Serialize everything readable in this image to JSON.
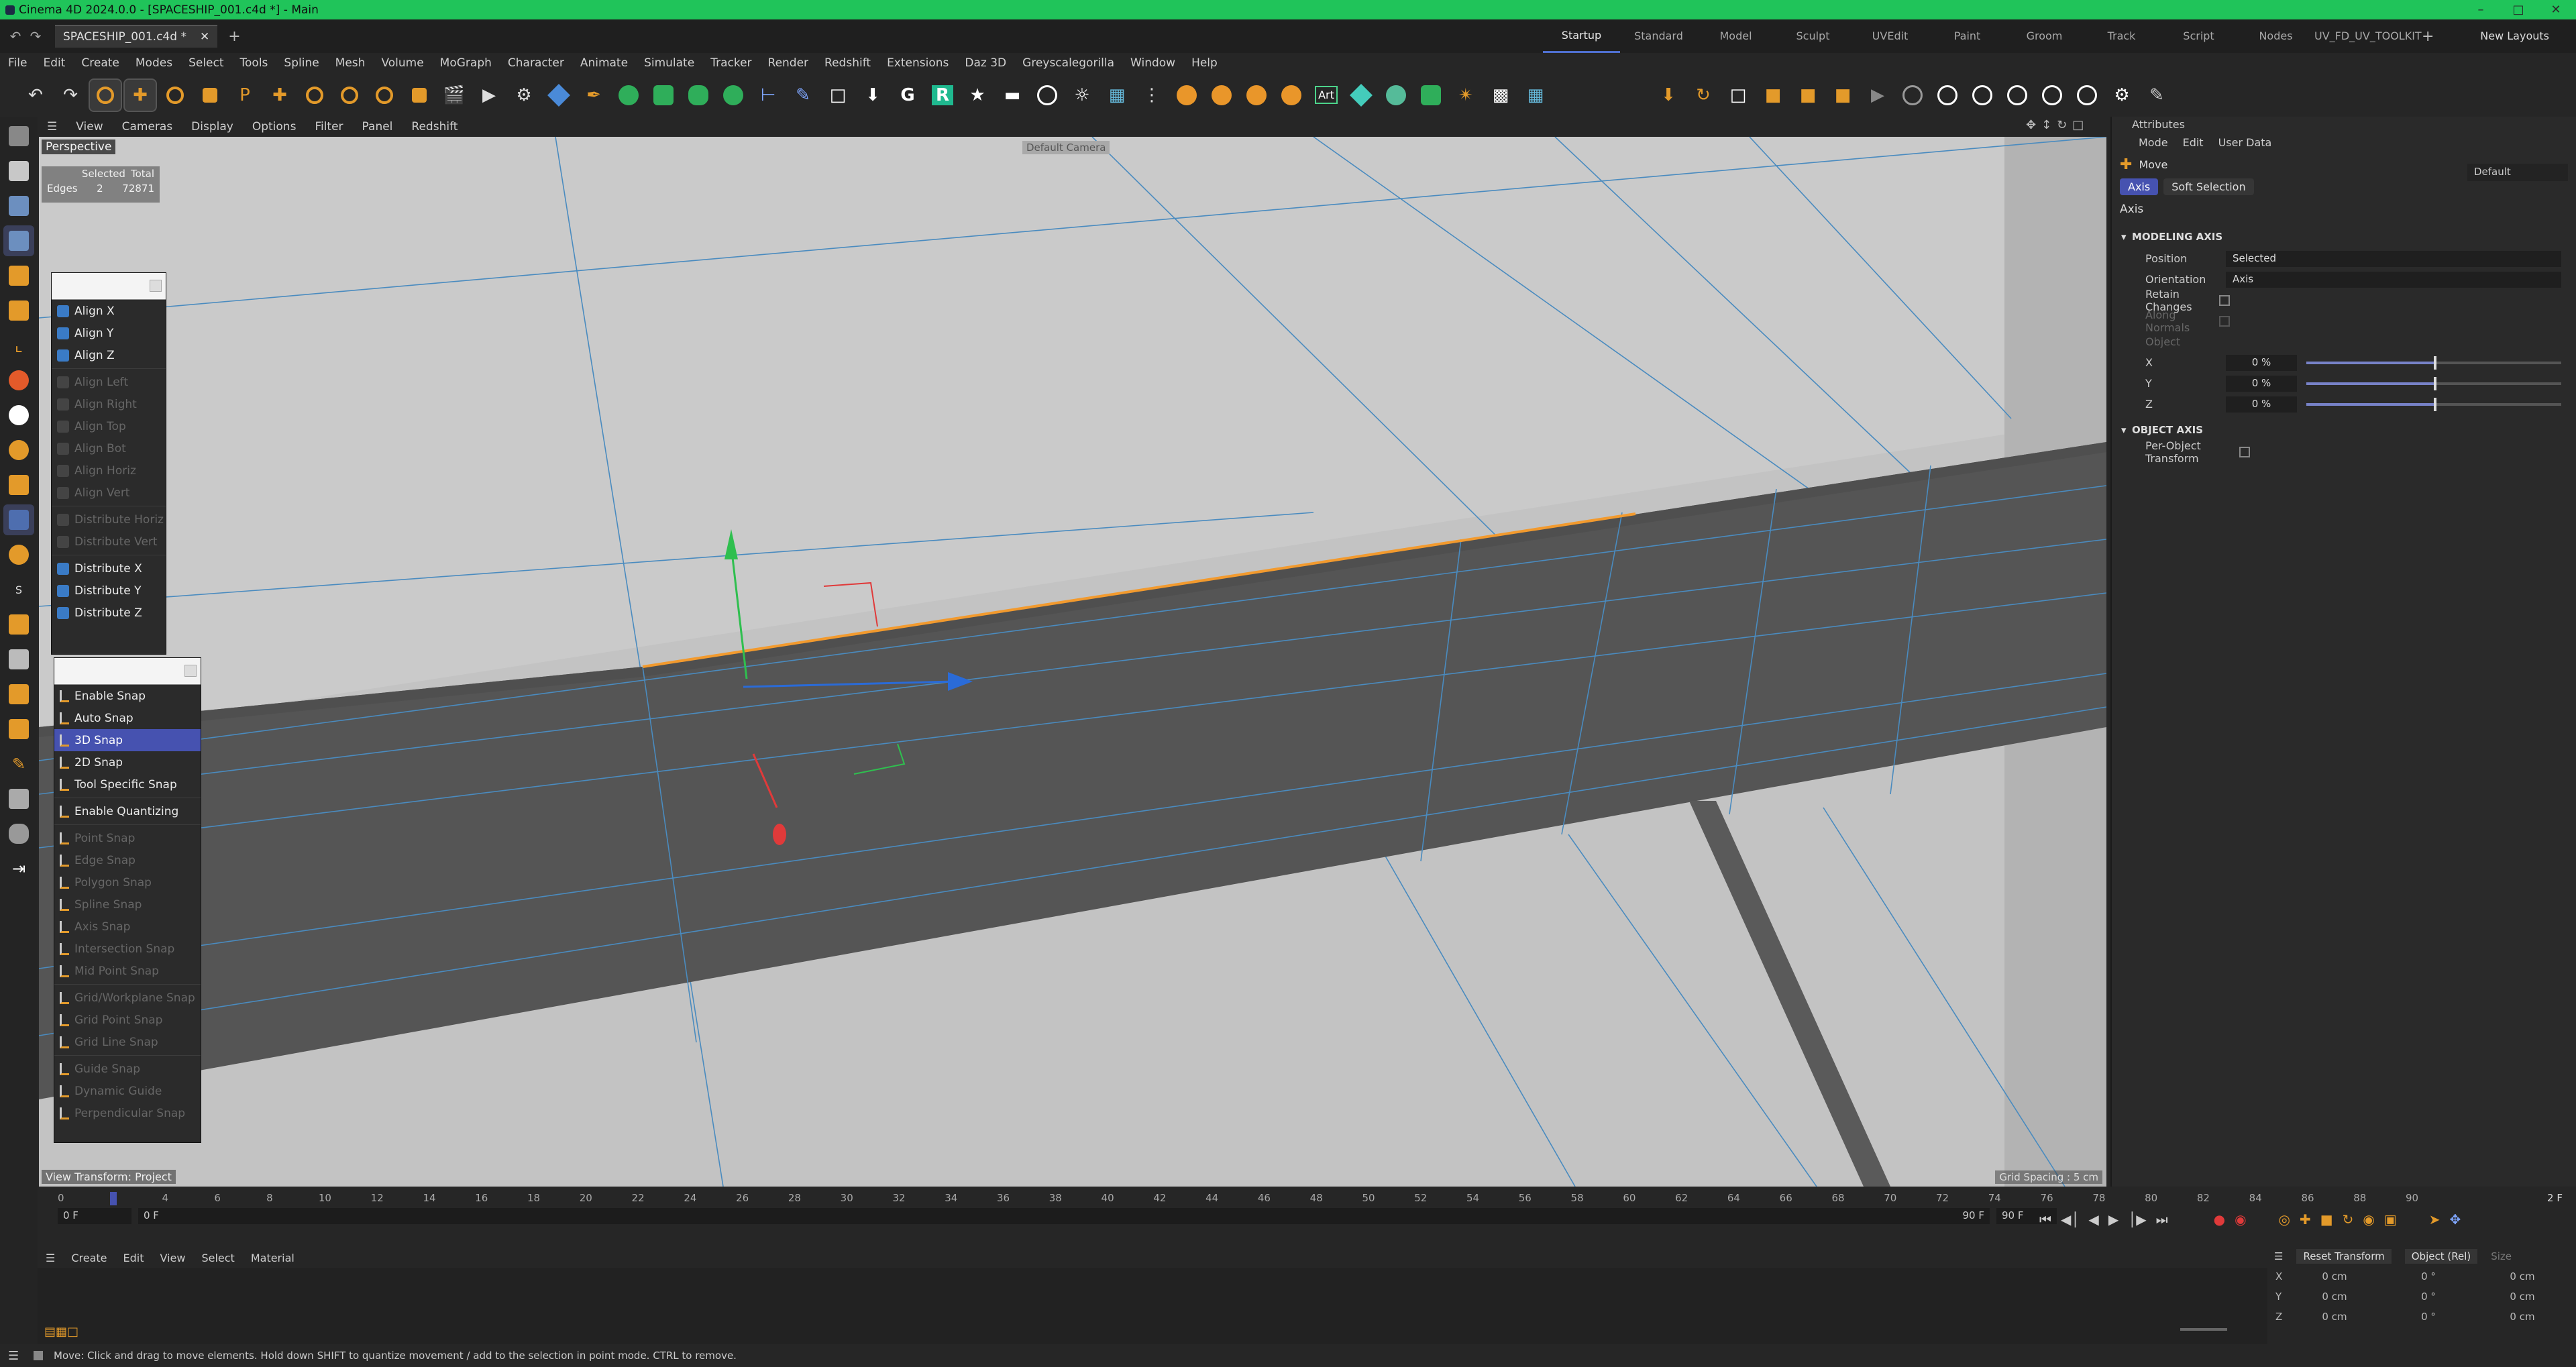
{
  "titlebar": {
    "text": "Cinema 4D 2024.0.0 - [SPACESHIP_001.c4d *] - Main"
  },
  "doc_tab": {
    "label": "SPACESHIP_001.c4d *"
  },
  "layouts": [
    "Startup",
    "Standard",
    "Model",
    "Sculpt",
    "UVEdit",
    "Paint",
    "Groom",
    "Track",
    "Script",
    "Nodes",
    "UV_FD_UV_TOOLKIT"
  ],
  "new_layouts": "New Layouts",
  "menubar": [
    "File",
    "Edit",
    "Create",
    "Modes",
    "Select",
    "Tools",
    "Spline",
    "Mesh",
    "Volume",
    "MoGraph",
    "Character",
    "Animate",
    "Simulate",
    "Tracker",
    "Render",
    "Redshift",
    "Extensions",
    "Daz 3D",
    "Greyscalegorilla",
    "Window",
    "Help"
  ],
  "viewport_menu": [
    "View",
    "Cameras",
    "Display",
    "Options",
    "Filter",
    "Panel",
    "Redshift"
  ],
  "viewport": {
    "name": "Perspective",
    "camera": "Default Camera",
    "hud": {
      "col1": "Selected",
      "col2": "Total",
      "row_label": "Edges",
      "selected": "2",
      "total": "72871"
    },
    "view_transform": "View Transform: Project",
    "grid_spacing": "Grid Spacing : 5 cm"
  },
  "align_menu": {
    "items": [
      {
        "label": "Align X",
        "enabled": true
      },
      {
        "label": "Align Y",
        "enabled": true
      },
      {
        "label": "Align Z",
        "enabled": true
      },
      {
        "label": "Align Left",
        "enabled": false
      },
      {
        "label": "Align Right",
        "enabled": false
      },
      {
        "label": "Align Top",
        "enabled": false
      },
      {
        "label": "Align Bot",
        "enabled": false
      },
      {
        "label": "Align Horiz",
        "enabled": false
      },
      {
        "label": "Align Vert",
        "enabled": false
      },
      {
        "label": "Distribute Horiz",
        "enabled": false
      },
      {
        "label": "Distribute Vert",
        "enabled": false
      },
      {
        "label": "Distribute X",
        "enabled": true
      },
      {
        "label": "Distribute Y",
        "enabled": true
      },
      {
        "label": "Distribute Z",
        "enabled": true
      }
    ]
  },
  "snap_menu": {
    "items": [
      {
        "label": "Enable Snap",
        "enabled": true,
        "highlight": false
      },
      {
        "label": "Auto Snap",
        "enabled": true,
        "highlight": false
      },
      {
        "label": "3D Snap",
        "enabled": true,
        "highlight": true
      },
      {
        "label": "2D Snap",
        "enabled": true,
        "highlight": false
      },
      {
        "label": "Tool Specific Snap",
        "enabled": true,
        "highlight": false
      },
      {
        "label": "Enable Quantizing",
        "enabled": true,
        "highlight": false
      },
      {
        "label": "Point Snap",
        "enabled": false,
        "highlight": false
      },
      {
        "label": "Edge Snap",
        "enabled": false,
        "highlight": false
      },
      {
        "label": "Polygon Snap",
        "enabled": false,
        "highlight": false
      },
      {
        "label": "Spline Snap",
        "enabled": false,
        "highlight": false
      },
      {
        "label": "Axis Snap",
        "enabled": false,
        "highlight": false
      },
      {
        "label": "Intersection Snap",
        "enabled": false,
        "highlight": false
      },
      {
        "label": "Mid Point Snap",
        "enabled": false,
        "highlight": false
      },
      {
        "label": "Grid/Workplane Snap",
        "enabled": false,
        "highlight": false
      },
      {
        "label": "Grid Point Snap",
        "enabled": false,
        "highlight": false
      },
      {
        "label": "Grid Line Snap",
        "enabled": false,
        "highlight": false
      },
      {
        "label": "Guide Snap",
        "enabled": false,
        "highlight": false
      },
      {
        "label": "Dynamic Guide",
        "enabled": false,
        "highlight": false
      },
      {
        "label": "Perpendicular Snap",
        "enabled": false,
        "highlight": false
      }
    ]
  },
  "attributes": {
    "title": "Attributes",
    "menu": [
      "Mode",
      "Edit",
      "User Data"
    ],
    "tool": "Move",
    "preset": "Default",
    "tabs": [
      {
        "label": "Axis",
        "active": true
      },
      {
        "label": "Soft Selection",
        "active": false
      }
    ],
    "section_title": "Axis",
    "modeling_axis": {
      "heading": "MODELING AXIS",
      "position_label": "Position",
      "position_value": "Selected",
      "orientation_label": "Orientation",
      "orientation_value": "Axis",
      "retain_label": "Retain Changes",
      "along_label": "Along Normals",
      "object_label": "Object",
      "x_label": "X",
      "x_value": "0 %",
      "y_label": "Y",
      "y_value": "0 %",
      "z_label": "Z",
      "z_value": "0 %"
    },
    "object_axis": {
      "heading": "OBJECT AXIS",
      "per_object_label": "Per-Object Transform"
    }
  },
  "timeline": {
    "ticks": [
      "0",
      "2",
      "4",
      "6",
      "8",
      "10",
      "12",
      "14",
      "16",
      "18",
      "20",
      "22",
      "24",
      "26",
      "28",
      "30",
      "32",
      "34",
      "36",
      "38",
      "40",
      "42",
      "44",
      "46",
      "48",
      "50",
      "52",
      "54",
      "56",
      "58",
      "60",
      "62",
      "64",
      "66",
      "68",
      "70",
      "72",
      "74",
      "76",
      "78",
      "80",
      "82",
      "84",
      "86",
      "88",
      "90"
    ],
    "current_frame": "2 F",
    "start": "0 F",
    "start2": "0 F",
    "end": "90 F",
    "end2": "90 F"
  },
  "bottom_menu": [
    "Create",
    "Edit",
    "View",
    "Select",
    "Material"
  ],
  "coord_manager": {
    "reset": "Reset Transform",
    "mode": "Object (Rel)",
    "size": "Size",
    "rows": [
      {
        "axis": "X",
        "pos": "0 cm",
        "rot": "0 °",
        "size": "0 cm"
      },
      {
        "axis": "Y",
        "pos": "0 cm",
        "rot": "0 °",
        "size": "0 cm"
      },
      {
        "axis": "Z",
        "pos": "0 cm",
        "rot": "0 °",
        "size": "0 cm"
      }
    ]
  },
  "status": "Move: Click and drag to move elements. Hold down SHIFT to quantize movement / add to the selection in point mode. CTRL to remove.",
  "colors": {
    "titlebar": "#20c45a",
    "accent": "#4652b0",
    "orange": "#e39a2a",
    "selection_edge": "#f29a2e"
  }
}
